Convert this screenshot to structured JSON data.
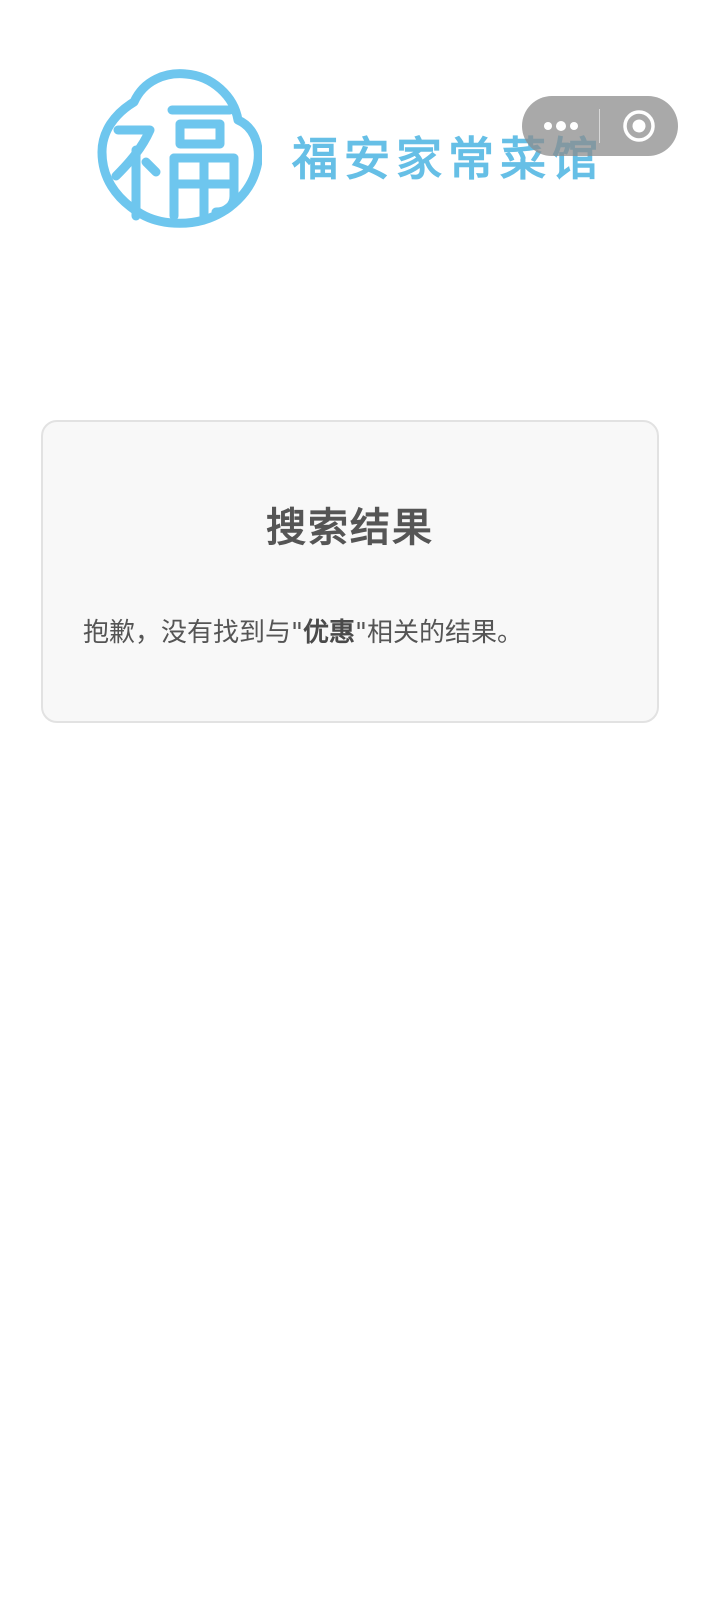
{
  "header": {
    "brand_name": "福安家常菜馆",
    "logo_icon": "fu-character-logo-icon",
    "brand_color": "#66bfe6"
  },
  "capsule": {
    "more_icon": "more-dots-icon",
    "close_icon": "target-circle-icon"
  },
  "result": {
    "title": "搜索结果",
    "message_prefix": "抱歉，没有找到与\"",
    "keyword": "优惠",
    "message_suffix": "\"相关的结果。"
  }
}
